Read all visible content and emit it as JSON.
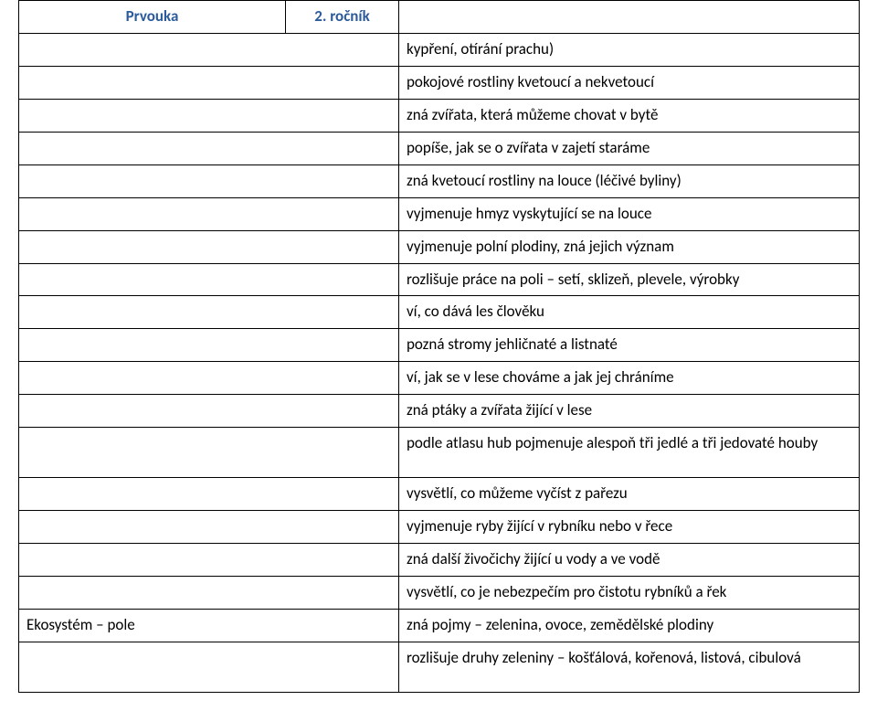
{
  "header": {
    "col1": "Prvouka",
    "col2": "2. ročník",
    "col3": ""
  },
  "rows": [
    {
      "left": "",
      "right": "kypření, otírání prachu)"
    },
    {
      "left": "",
      "right": "pokojové rostliny kvetoucí a nekvetoucí"
    },
    {
      "left": "",
      "right": "zná zvířata, která můžeme chovat v bytě"
    },
    {
      "left": "",
      "right": "popíše, jak se o zvířata v zajetí staráme"
    },
    {
      "left": "",
      "right": "zná kvetoucí rostliny na louce (léčivé byliny)"
    },
    {
      "left": "",
      "right": "vyjmenuje hmyz vyskytující se na louce"
    },
    {
      "left": "",
      "right": "vyjmenuje polní plodiny, zná jejich význam"
    },
    {
      "left": "",
      "right": "rozlišuje práce na poli – setí, sklizeň, plevele, výrobky"
    },
    {
      "left": "",
      "right": "ví, co dává les člověku"
    },
    {
      "left": "",
      "right": "pozná stromy jehličnaté a listnaté"
    },
    {
      "left": "",
      "right": "ví, jak se v lese chováme a jak jej chráníme"
    },
    {
      "left": "",
      "right": "zná ptáky a zvířata žijící v lese"
    },
    {
      "left": "",
      "right": "podle atlasu hub pojmenuje alespoň tři jedlé a tři jedovaté houby",
      "tall": true,
      "justify": true
    },
    {
      "left": "",
      "right": "vysvětlí, co můžeme vyčíst z pařezu"
    },
    {
      "left": "",
      "right": "vyjmenuje ryby žijící v rybníku nebo v řece"
    },
    {
      "left": "",
      "right": "zná další živočichy žijící u vody a ve vodě"
    },
    {
      "left": "",
      "right": "vysvětlí, co je nebezpečím pro čistotu rybníků a řek"
    },
    {
      "left": "Ekosystém – pole",
      "right": "zná pojmy – zelenina, ovoce, zemědělské plodiny"
    },
    {
      "left": "",
      "right": "rozlišuje druhy zeleniny – košťálová, kořenová, listová, cibulová",
      "tall": true,
      "justify": true
    }
  ]
}
